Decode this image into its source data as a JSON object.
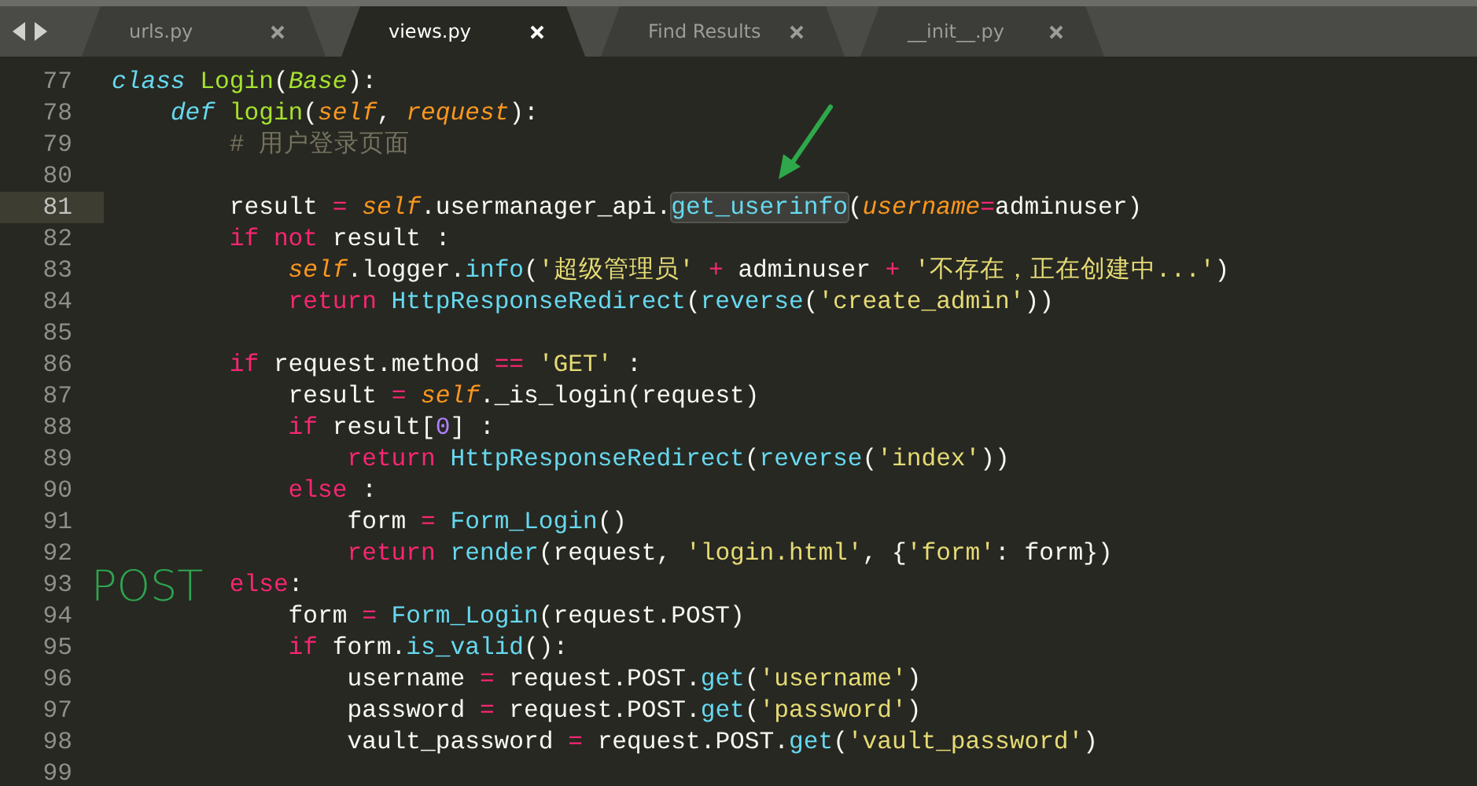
{
  "tabs": [
    {
      "label": "urls.py",
      "selected": false
    },
    {
      "label": "views.py",
      "selected": true
    },
    {
      "label": "Find Results",
      "selected": false
    },
    {
      "label": "__init__.py",
      "selected": false
    }
  ],
  "editor": {
    "side_note": "POST",
    "lines": [
      {
        "number": "77",
        "current": false,
        "tokens": [
          {
            "kind": "storage",
            "text": "class"
          },
          {
            "kind": "entity",
            "text": " Login"
          },
          {
            "kind": "plain",
            "text": "("
          },
          {
            "kind": "inherited",
            "text": "Base"
          },
          {
            "kind": "plain",
            "text": "):"
          }
        ]
      },
      {
        "number": "78",
        "current": false,
        "tokens": [
          {
            "kind": "storage",
            "text": "    def"
          },
          {
            "kind": "entity",
            "text": " login"
          },
          {
            "kind": "plain",
            "text": "("
          },
          {
            "kind": "param",
            "text": "self"
          },
          {
            "kind": "plain",
            "text": ", "
          },
          {
            "kind": "param",
            "text": "request"
          },
          {
            "kind": "plain",
            "text": "):"
          }
        ]
      },
      {
        "number": "79",
        "current": false,
        "tokens": [
          {
            "kind": "comment",
            "text": "        # 用户登录页面"
          }
        ]
      },
      {
        "number": "80",
        "current": false
      },
      {
        "number": "81",
        "current": true,
        "tokens": [
          {
            "kind": "plain",
            "text": "        result "
          },
          {
            "kind": "operator",
            "text": "="
          },
          {
            "kind": "param",
            "text": " self"
          },
          {
            "kind": "plain",
            "text": ".usermanager_api."
          },
          {
            "kind": "call",
            "text": "get_userinfo",
            "match": true
          },
          {
            "kind": "plain",
            "text": "("
          },
          {
            "kind": "param",
            "text": "username"
          },
          {
            "kind": "operator",
            "text": "="
          },
          {
            "kind": "plain",
            "text": "adminuser)"
          }
        ]
      },
      {
        "number": "82",
        "current": false,
        "tokens": [
          {
            "kind": "keyword",
            "text": "        if"
          },
          {
            "kind": "keyword",
            "text": " not"
          },
          {
            "kind": "plain",
            "text": " result :"
          }
        ]
      },
      {
        "number": "83",
        "current": false,
        "tokens": [
          {
            "kind": "param",
            "text": "            self"
          },
          {
            "kind": "plain",
            "text": ".logger."
          },
          {
            "kind": "call",
            "text": "info"
          },
          {
            "kind": "plain",
            "text": "("
          },
          {
            "kind": "string",
            "text": "'超级管理员'"
          },
          {
            "kind": "operator",
            "text": " +"
          },
          {
            "kind": "plain",
            "text": " adminuser "
          },
          {
            "kind": "operator",
            "text": "+"
          },
          {
            "kind": "string",
            "text": " '不存在，正在创建中...'"
          },
          {
            "kind": "plain",
            "text": ")"
          }
        ]
      },
      {
        "number": "84",
        "current": false,
        "tokens": [
          {
            "kind": "keyword",
            "text": "            return"
          },
          {
            "kind": "call",
            "text": " HttpResponseRedirect"
          },
          {
            "kind": "plain",
            "text": "("
          },
          {
            "kind": "call",
            "text": "reverse"
          },
          {
            "kind": "plain",
            "text": "("
          },
          {
            "kind": "string",
            "text": "'create_admin'"
          },
          {
            "kind": "plain",
            "text": "))"
          }
        ]
      },
      {
        "number": "85",
        "current": false
      },
      {
        "number": "86",
        "current": false,
        "tokens": [
          {
            "kind": "keyword",
            "text": "        if"
          },
          {
            "kind": "plain",
            "text": " request.method "
          },
          {
            "kind": "operator",
            "text": "=="
          },
          {
            "kind": "string",
            "text": " 'GET'"
          },
          {
            "kind": "plain",
            "text": " :"
          }
        ]
      },
      {
        "number": "87",
        "current": false,
        "tokens": [
          {
            "kind": "plain",
            "text": "            result "
          },
          {
            "kind": "operator",
            "text": "="
          },
          {
            "kind": "param",
            "text": " self"
          },
          {
            "kind": "plain",
            "text": "._is_login(request)"
          }
        ]
      },
      {
        "number": "88",
        "current": false,
        "tokens": [
          {
            "kind": "keyword",
            "text": "            if"
          },
          {
            "kind": "plain",
            "text": " result["
          },
          {
            "kind": "number",
            "text": "0"
          },
          {
            "kind": "plain",
            "text": "] :"
          }
        ]
      },
      {
        "number": "89",
        "current": false,
        "tokens": [
          {
            "kind": "keyword",
            "text": "                return"
          },
          {
            "kind": "call",
            "text": " HttpResponseRedirect"
          },
          {
            "kind": "plain",
            "text": "("
          },
          {
            "kind": "call",
            "text": "reverse"
          },
          {
            "kind": "plain",
            "text": "("
          },
          {
            "kind": "string",
            "text": "'index'"
          },
          {
            "kind": "plain",
            "text": "))"
          }
        ]
      },
      {
        "number": "90",
        "current": false,
        "tokens": [
          {
            "kind": "keyword",
            "text": "            else"
          },
          {
            "kind": "plain",
            "text": " :"
          }
        ]
      },
      {
        "number": "91",
        "current": false,
        "tokens": [
          {
            "kind": "plain",
            "text": "                form "
          },
          {
            "kind": "operator",
            "text": "="
          },
          {
            "kind": "call",
            "text": " Form_Login"
          },
          {
            "kind": "plain",
            "text": "()"
          }
        ]
      },
      {
        "number": "92",
        "current": false,
        "tokens": [
          {
            "kind": "keyword",
            "text": "                return"
          },
          {
            "kind": "call",
            "text": " render"
          },
          {
            "kind": "plain",
            "text": "(request, "
          },
          {
            "kind": "string",
            "text": "'login.html'"
          },
          {
            "kind": "plain",
            "text": ", {"
          },
          {
            "kind": "string",
            "text": "'form'"
          },
          {
            "kind": "plain",
            "text": ": form})"
          }
        ]
      },
      {
        "number": "93",
        "current": false,
        "tokens": [
          {
            "kind": "keyword",
            "text": "        else"
          },
          {
            "kind": "plain",
            "text": ":"
          }
        ]
      },
      {
        "number": "94",
        "current": false,
        "tokens": [
          {
            "kind": "plain",
            "text": "            form "
          },
          {
            "kind": "operator",
            "text": "="
          },
          {
            "kind": "call",
            "text": " Form_Login"
          },
          {
            "kind": "plain",
            "text": "(request.POST)"
          }
        ]
      },
      {
        "number": "95",
        "current": false,
        "tokens": [
          {
            "kind": "keyword",
            "text": "            if"
          },
          {
            "kind": "plain",
            "text": " form."
          },
          {
            "kind": "call",
            "text": "is_valid"
          },
          {
            "kind": "plain",
            "text": "():"
          }
        ]
      },
      {
        "number": "96",
        "current": false,
        "tokens": [
          {
            "kind": "plain",
            "text": "                username "
          },
          {
            "kind": "operator",
            "text": "="
          },
          {
            "kind": "plain",
            "text": " request.POST."
          },
          {
            "kind": "call",
            "text": "get"
          },
          {
            "kind": "plain",
            "text": "("
          },
          {
            "kind": "string",
            "text": "'username'"
          },
          {
            "kind": "plain",
            "text": ")"
          }
        ]
      },
      {
        "number": "97",
        "current": false,
        "tokens": [
          {
            "kind": "plain",
            "text": "                password "
          },
          {
            "kind": "operator",
            "text": "="
          },
          {
            "kind": "plain",
            "text": " request.POST."
          },
          {
            "kind": "call",
            "text": "get"
          },
          {
            "kind": "plain",
            "text": "("
          },
          {
            "kind": "string",
            "text": "'password'"
          },
          {
            "kind": "plain",
            "text": ")"
          }
        ]
      },
      {
        "number": "98",
        "current": false,
        "tokens": [
          {
            "kind": "plain",
            "text": "                vault_password "
          },
          {
            "kind": "operator",
            "text": "="
          },
          {
            "kind": "plain",
            "text": " request.POST."
          },
          {
            "kind": "call",
            "text": "get"
          },
          {
            "kind": "plain",
            "text": "("
          },
          {
            "kind": "string",
            "text": "'vault_password'"
          },
          {
            "kind": "plain",
            "text": ")"
          }
        ]
      },
      {
        "number": "99",
        "current": false
      }
    ]
  }
}
